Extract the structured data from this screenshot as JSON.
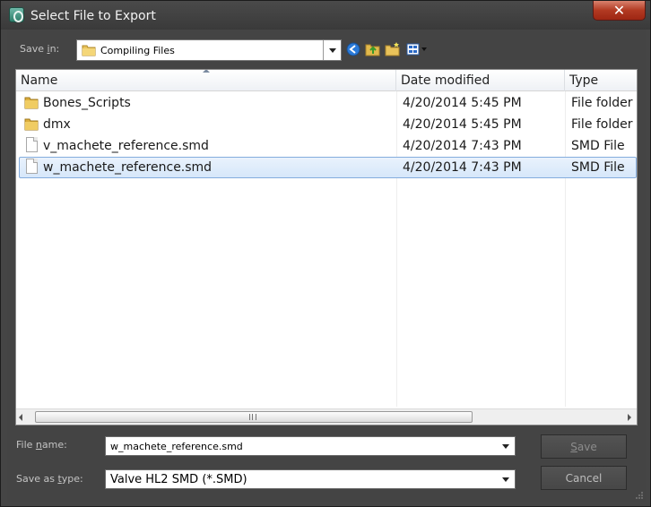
{
  "window": {
    "title": "Select File to Export",
    "close_label": "✕"
  },
  "toolbar": {
    "save_in_label_pre": "Save ",
    "save_in_label_u": "i",
    "save_in_label_post": "n:",
    "current_folder": "Compiling Files",
    "icons": [
      "back-icon",
      "up-folder-icon",
      "new-folder-icon",
      "view-menu-icon"
    ]
  },
  "list": {
    "columns": {
      "name": "Name",
      "date_modified": "Date modified",
      "type": "Type"
    },
    "rows": [
      {
        "name": "Bones_Scripts",
        "date": "4/20/2014 5:45 PM",
        "type": "File folder",
        "kind": "folder",
        "selected": false
      },
      {
        "name": "dmx",
        "date": "4/20/2014 5:45 PM",
        "type": "File folder",
        "kind": "folder",
        "selected": false
      },
      {
        "name": "v_machete_reference.smd",
        "date": "4/20/2014 7:43 PM",
        "type": "SMD File",
        "kind": "file",
        "selected": false
      },
      {
        "name": "w_machete_reference.smd",
        "date": "4/20/2014 7:43 PM",
        "type": "SMD File",
        "kind": "file",
        "selected": true
      }
    ]
  },
  "footer": {
    "file_name_label_pre": "File ",
    "file_name_label_u": "n",
    "file_name_label_post": "ame:",
    "file_name_value": "w_machete_reference.smd",
    "save_type_label_pre": "Save as ",
    "save_type_label_u": "t",
    "save_type_label_post": "ype:",
    "save_type_value": "Valve HL2 SMD (*.SMD)",
    "save_button_u": "S",
    "save_button_rest": "ave",
    "cancel_button": "Cancel"
  },
  "colors": {
    "background": "#454545",
    "selection": "#d6e7fa",
    "close": "#b23a22"
  }
}
